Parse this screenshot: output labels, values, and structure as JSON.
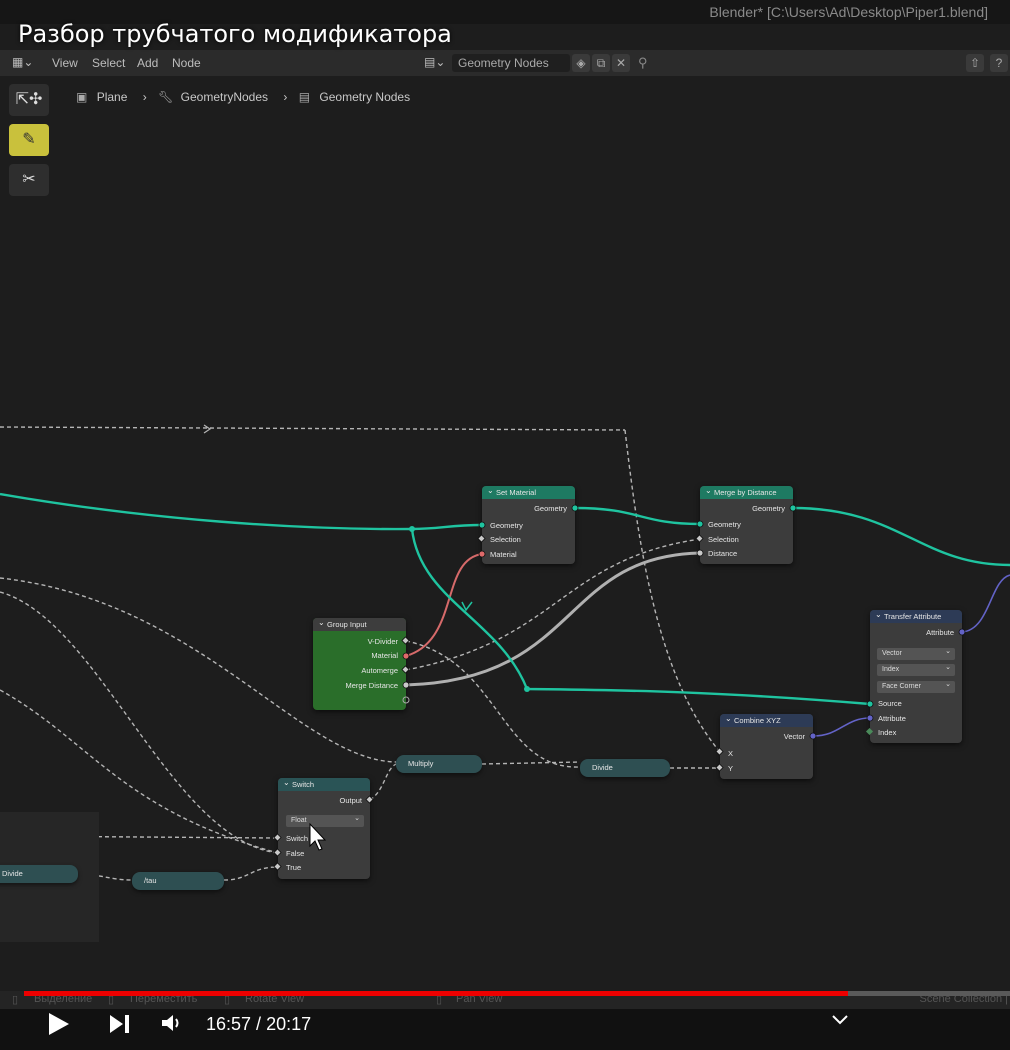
{
  "video": {
    "title": "Разбор трубчатого модификатора",
    "current_time": "16:57",
    "separator": " / ",
    "duration": "20:17",
    "progress_fraction": 0.836
  },
  "window": {
    "title": "Blender* [C:\\Users\\Ad\\Desktop\\Piper1.blend]"
  },
  "header": {
    "menus": [
      "View",
      "Select",
      "Add",
      "Node"
    ],
    "node_tree_name": "Geometry Nodes"
  },
  "breadcrumb": [
    "Plane",
    "GeometryNodes",
    "Geometry Nodes"
  ],
  "nodes": {
    "set_material": {
      "title": "Set Material",
      "out_geometry": "Geometry",
      "in_geometry": "Geometry",
      "in_selection": "Selection",
      "in_material": "Material"
    },
    "merge_by_distance": {
      "title": "Merge by Distance",
      "out_geometry": "Geometry",
      "in_geometry": "Geometry",
      "in_selection": "Selection",
      "in_distance": "Distance"
    },
    "group_input": {
      "title": "Group Input",
      "out_v_divider": "V-Divider",
      "out_material": "Material",
      "out_automerge": "Automerge",
      "out_merge_distance": "Merge Distance"
    },
    "transfer_attribute": {
      "title": "Transfer Attribute",
      "out_attribute": "Attribute",
      "dd_type": "Vector",
      "dd_mode": "Index",
      "dd_domain": "Face Corner",
      "in_source": "Source",
      "in_attribute": "Attribute",
      "in_index": "Index"
    },
    "combine_xyz": {
      "title": "Combine XYZ",
      "out_vector": "Vector",
      "in_x": "X",
      "in_y": "Y"
    },
    "switch": {
      "title": "Switch",
      "out_output": "Output",
      "dd_type": "Float",
      "in_switch": "Switch",
      "in_false": "False",
      "in_true": "True"
    },
    "multiply": {
      "title": "Multiply"
    },
    "divide_right": {
      "title": "Divide"
    },
    "divide_left": {
      "title": "Divide"
    },
    "tau": {
      "title": "/tau"
    }
  },
  "status_bar": {
    "select": "Выделение",
    "move": "Переместить",
    "rotate": "Rotate View",
    "pan": "Pan View",
    "scene": "Scene Collection |"
  },
  "colors": {
    "geometry_link": "#1fc4a0",
    "material_link": "#e06a6a",
    "float_link": "#a0a0a0",
    "vector_link": "#6363c7",
    "group_input_body": "#2a6e2a",
    "progress": "#ee0000"
  }
}
